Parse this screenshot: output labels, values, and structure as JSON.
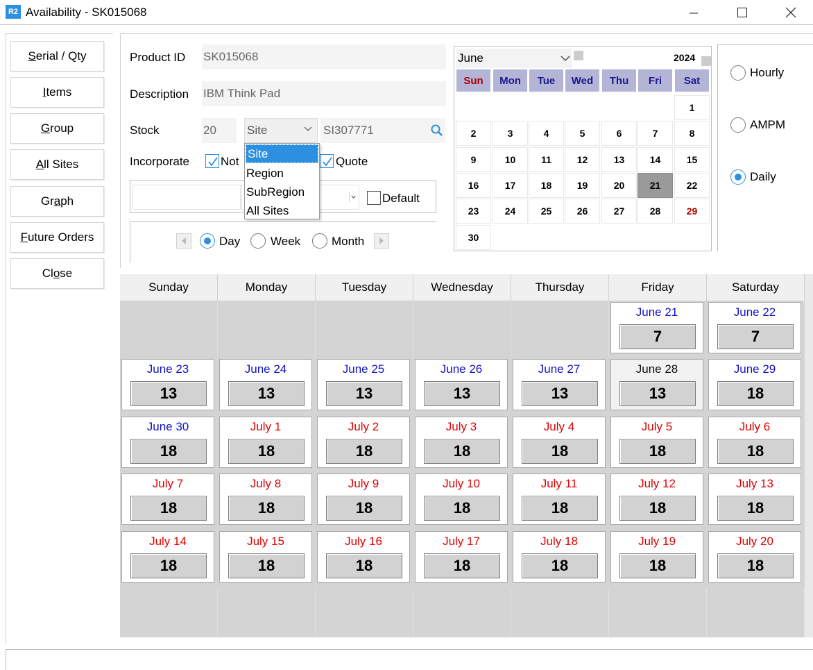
{
  "window": {
    "icon_text": "R2",
    "title": "Availability - SK015068"
  },
  "sidebar": {
    "buttons": [
      {
        "pre": "",
        "u": "S",
        "post": "erial / Qty"
      },
      {
        "pre": "",
        "u": "I",
        "post": "tems"
      },
      {
        "pre": "",
        "u": "G",
        "post": "roup"
      },
      {
        "pre": "",
        "u": "A",
        "post": "ll Sites"
      },
      {
        "pre": "Gr",
        "u": "a",
        "post": "ph"
      },
      {
        "pre": "",
        "u": "F",
        "post": "uture Orders"
      },
      {
        "pre": "Cl",
        "u": "o",
        "post": "se"
      }
    ]
  },
  "form": {
    "product_id_label": "Product ID",
    "product_id": "SK015068",
    "description_label": "Description",
    "description": "IBM Think Pad",
    "stock_label": "Stock",
    "stock_qty": "20",
    "stock_scope": "Site",
    "site_code": "SI307771",
    "incorporate_label": "Incorporate",
    "not_label": "Not",
    "quote_label": "Quote",
    "default_select_text": "e",
    "default_label": "Default",
    "period_day": "Day",
    "period_week": "Week",
    "period_month": "Month"
  },
  "dropdown": {
    "options": [
      "Site",
      "Region",
      "SubRegion",
      "All Sites"
    ],
    "selected": "Site"
  },
  "mini_calendar": {
    "month": "June",
    "year": "2024",
    "weekdays": [
      "Sun",
      "Mon",
      "Tue",
      "Wed",
      "Thu",
      "Fri",
      "Sat"
    ],
    "rows": [
      [
        "",
        "",
        "",
        "",
        "",
        "",
        "1"
      ],
      [
        "2",
        "3",
        "4",
        "5",
        "6",
        "7",
        "8"
      ],
      [
        "9",
        "10",
        "11",
        "12",
        "13",
        "14",
        "15"
      ],
      [
        "16",
        "17",
        "18",
        "19",
        "20",
        "21",
        "22"
      ],
      [
        "23",
        "24",
        "25",
        "26",
        "27",
        "28",
        "29"
      ],
      [
        "30",
        "",
        "",
        "",
        "",
        "",
        ""
      ]
    ],
    "selected_day": "21",
    "highlight_red_day": "29"
  },
  "view_options": {
    "hourly": "Hourly",
    "ampm": "AMPM",
    "daily": "Daily",
    "selected": "Daily"
  },
  "grid": {
    "weekdays": [
      "Sunday",
      "Monday",
      "Tuesday",
      "Wednesday",
      "Thursday",
      "Friday",
      "Saturday"
    ],
    "weeks": [
      [
        null,
        null,
        null,
        null,
        null,
        {
          "date": "June 21",
          "value": "7",
          "color": "blue"
        },
        {
          "date": "June 22",
          "value": "7",
          "color": "blue"
        }
      ],
      [
        {
          "date": "June 23",
          "value": "13",
          "color": "blue"
        },
        {
          "date": "June 24",
          "value": "13",
          "color": "blue"
        },
        {
          "date": "June 25",
          "value": "13",
          "color": "blue"
        },
        {
          "date": "June 26",
          "value": "13",
          "color": "blue"
        },
        {
          "date": "June 27",
          "value": "13",
          "color": "blue"
        },
        {
          "date": "June 28",
          "value": "13",
          "color": "black",
          "current": true
        },
        {
          "date": "June 29",
          "value": "18",
          "color": "blue"
        }
      ],
      [
        {
          "date": "June 30",
          "value": "18",
          "color": "blue"
        },
        {
          "date": "July 1",
          "value": "18",
          "color": "red"
        },
        {
          "date": "July 2",
          "value": "18",
          "color": "red"
        },
        {
          "date": "July 3",
          "value": "18",
          "color": "red"
        },
        {
          "date": "July 4",
          "value": "18",
          "color": "red"
        },
        {
          "date": "July 5",
          "value": "18",
          "color": "red"
        },
        {
          "date": "July 6",
          "value": "18",
          "color": "red"
        }
      ],
      [
        {
          "date": "July 7",
          "value": "18",
          "color": "red"
        },
        {
          "date": "July 8",
          "value": "18",
          "color": "red"
        },
        {
          "date": "July 9",
          "value": "18",
          "color": "red"
        },
        {
          "date": "July 10",
          "value": "18",
          "color": "red"
        },
        {
          "date": "July 11",
          "value": "18",
          "color": "red"
        },
        {
          "date": "July 12",
          "value": "18",
          "color": "red"
        },
        {
          "date": "July 13",
          "value": "18",
          "color": "red"
        }
      ],
      [
        {
          "date": "July 14",
          "value": "18",
          "color": "red"
        },
        {
          "date": "July 15",
          "value": "18",
          "color": "red"
        },
        {
          "date": "July 16",
          "value": "18",
          "color": "red"
        },
        {
          "date": "July 17",
          "value": "18",
          "color": "red"
        },
        {
          "date": "July 18",
          "value": "18",
          "color": "red"
        },
        {
          "date": "July 19",
          "value": "18",
          "color": "red"
        },
        {
          "date": "July 20",
          "value": "18",
          "color": "red"
        }
      ]
    ]
  },
  "colors": {
    "accent": "#2d8fe0",
    "date_blue": "#1414c8",
    "date_red": "#e10000",
    "header_lavender": "#b4b4d6"
  }
}
